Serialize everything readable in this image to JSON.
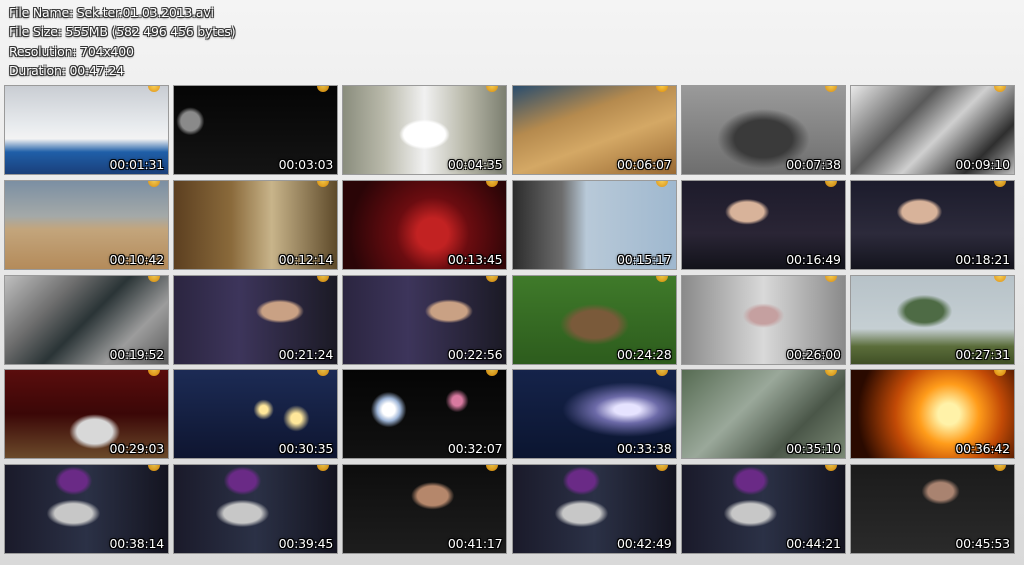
{
  "info": {
    "file_name": "File Name: Sek.ter.01.03.2013.avi",
    "file_size": "File Size: 555MB (582 496 456 bytes)",
    "resolution": "Resolution: 704x400",
    "duration": "Duration: 00:47:24"
  },
  "thumbnails": [
    {
      "time": "00:01:31",
      "scene": "man-in-winter-snow",
      "bg": "linear-gradient(180deg,#c9cdd3 0%,#e8ebee 45%,#f3f3f3 60%,#1f5fa8 75%,#1a3f7a 100%)"
    },
    {
      "time": "00:03:03",
      "scene": "dark-space-asteroid",
      "bg": "radial-gradient(circle at 10% 40%,#8a8a8a 0 6%,transparent 9%),linear-gradient(#050505,#141414)"
    },
    {
      "time": "00:04:35",
      "scene": "hands-holding-paper",
      "bg": "radial-gradient(ellipse at 50% 55%,#ffffff 0 18%,transparent 22%),linear-gradient(90deg,#8a8d7d 0%,#b9b9aa 25%,#f1f1f1 50%,#b9b9aa 75%,#7c7f70 100%)"
    },
    {
      "time": "00:06:07",
      "scene": "ancient-city-model",
      "bg": "linear-gradient(160deg,#2a4d6e 0%,#b58a4e 35%,#d4a865 60%,#9a6a33 100%)"
    },
    {
      "time": "00:07:38",
      "scene": "aerial-crater-bw",
      "bg": "radial-gradient(ellipse at 50% 60%,#3a3a3a 0 25%,transparent 40%),linear-gradient(#9a9a9a,#6e6e6e)"
    },
    {
      "time": "00:09:10",
      "scene": "excavation-bw",
      "bg": "linear-gradient(135deg,#e9e9e9 0%,#5a5a5a 35%,#cfcfcf 55%,#2e2e2e 80%,#bdbdbd 100%)"
    },
    {
      "time": "00:10:42",
      "scene": "desert-dust-storm",
      "bg": "linear-gradient(180deg,#7b8fa3 0%,#a4a9a8 40%,#c3a57c 55%,#b48b5a 100%)"
    },
    {
      "time": "00:12:14",
      "scene": "cave-palm-trees",
      "bg": "linear-gradient(90deg,#5c3f20 0%,#8a6a3b 35%,#c8b48a 60%,#5e4a2a 100%)"
    },
    {
      "time": "00:13:45",
      "scene": "red-planet-surface",
      "bg": "radial-gradient(circle at 55% 60%,#c22222 0 15%,#6b0c10 35%,#2a0507 80%)"
    },
    {
      "time": "00:15:17",
      "scene": "space-capsules",
      "bg": "linear-gradient(90deg,#2c2c2c 0%,#6d6d6d 30%,#b8c9d8 45%,#9fb8cf 100%)"
    },
    {
      "time": "00:16:49",
      "scene": "interview-man-1",
      "bg": "radial-gradient(ellipse at 40% 35%,#d8b39a 0 12%,transparent 16%),linear-gradient(180deg,#1d1b2b 0%,#2a2535 60%,#12121a 100%)"
    },
    {
      "time": "00:18:21",
      "scene": "interview-man-2",
      "bg": "radial-gradient(ellipse at 42% 35%,#d8b39a 0 13%,transparent 17%),linear-gradient(180deg,#1c1c2c 0%,#2c2a3b 60%,#14141d 100%)"
    },
    {
      "time": "00:19:52",
      "scene": "rock-texture",
      "bg": "linear-gradient(135deg,#bfbfbf 0%,#6d6d6d 30%,#2a3436 50%,#9c9c9c 75%,#5a5a5a 100%)"
    },
    {
      "time": "00:21:24",
      "scene": "interview-man-3",
      "bg": "radial-gradient(ellipse at 65% 40%,#c9a184 0 12%,transparent 16%),linear-gradient(90deg,#2b2540 0%,#3d355b 40%,#1b1a25 100%)"
    },
    {
      "time": "00:22:56",
      "scene": "interview-man-4",
      "bg": "radial-gradient(ellipse at 65% 40%,#c9a184 0 12%,transparent 16%),linear-gradient(90deg,#2b2540 0%,#3d355b 40%,#1b1a25 100%)"
    },
    {
      "time": "00:24:28",
      "scene": "jungle-temple",
      "bg": "radial-gradient(ellipse at 50% 55%,#7a5a3a 0 20%,transparent 30%),linear-gradient(#3f7a2a,#2d5c1d)"
    },
    {
      "time": "00:26:00",
      "scene": "temple-statue",
      "bg": "radial-gradient(ellipse at 50% 45%,#c5a0a0 0 12%,transparent 18%),linear-gradient(90deg,#8a8a8a,#d9d9d9 50%,#8a8a8a)"
    },
    {
      "time": "00:27:31",
      "scene": "tree-field",
      "bg": "radial-gradient(ellipse at 45% 40%,#4e6b45 0 15%,transparent 22%),linear-gradient(180deg,#b7c2c8 0%,#c5cfd3 60%,#5b6d3a 80%,#405026 100%)"
    },
    {
      "time": "00:29:03",
      "scene": "compass-on-table",
      "bg": "radial-gradient(ellipse at 55% 70%,#d8d8d8 0 14%,transparent 20%),linear-gradient(180deg,#5a0d0d 0%,#3b0707 50%,#6b4a2a 100%)"
    },
    {
      "time": "00:30:35",
      "scene": "candles-night",
      "bg": "radial-gradient(circle at 55% 45%,#ffe79a 0 4%,transparent 10%),radial-gradient(circle at 75% 55%,#ffe79a 0 4%,transparent 10%),linear-gradient(180deg,#1c2b55 0%,#0e1530 100%)"
    },
    {
      "time": "00:32:07",
      "scene": "dark-lights",
      "bg": "radial-gradient(circle at 28% 45%,#ffffff 0 5%,#9fb6d8 9%,transparent 14%),radial-gradient(circle at 70% 35%,#d87aa0 0 4%,transparent 9%),linear-gradient(#050505,#111)"
    },
    {
      "time": "00:33:38",
      "scene": "presenter-galaxy",
      "bg": "radial-gradient(ellipse at 70% 45%,#e6e3ff 0 8%,#6c6aa8 20%,transparent 40%),linear-gradient(180deg,#15234a 0%,#0b1530 100%)"
    },
    {
      "time": "00:35:10",
      "scene": "rubble-green",
      "bg": "linear-gradient(135deg,#566b52 0%,#9aa89a 40%,#4a5648 70%,#7c8a76 100%)"
    },
    {
      "time": "00:36:42",
      "scene": "explosion-fire",
      "bg": "radial-gradient(circle at 60% 50%,#fff2a8 0 10%,#ff9c1a 28%,#c24a06 50%,#2a0a00 85%)"
    },
    {
      "time": "00:38:14",
      "scene": "priest-interview-1",
      "bg": "radial-gradient(ellipse at 42% 18%,#6a2a86 0 10%,transparent 14%),radial-gradient(ellipse at 42% 55%,#c7c7c7 0 14%,transparent 20%),linear-gradient(90deg,#1a1a2a,#2b3146 50%,#141420)"
    },
    {
      "time": "00:39:45",
      "scene": "priest-interview-2",
      "bg": "radial-gradient(ellipse at 42% 18%,#6a2a86 0 10%,transparent 14%),radial-gradient(ellipse at 42% 55%,#c7c7c7 0 14%,transparent 20%),linear-gradient(90deg,#1a1a2a,#2b3146 50%,#141420)"
    },
    {
      "time": "00:41:17",
      "scene": "woman-interview",
      "bg": "radial-gradient(ellipse at 55% 35%,#b5876b 0 12%,transparent 17%),linear-gradient(180deg,#0d0d0d,#1d1d1d)"
    },
    {
      "time": "00:42:49",
      "scene": "priest-interview-3",
      "bg": "radial-gradient(ellipse at 42% 18%,#6a2a86 0 10%,transparent 14%),radial-gradient(ellipse at 42% 55%,#c7c7c7 0 14%,transparent 20%),linear-gradient(90deg,#1a1a2a,#2b3146 50%,#141420)"
    },
    {
      "time": "00:44:21",
      "scene": "priest-interview-4",
      "bg": "radial-gradient(ellipse at 42% 18%,#6a2a86 0 10%,transparent 14%),radial-gradient(ellipse at 42% 55%,#c7c7c7 0 14%,transparent 20%),linear-gradient(90deg,#1a1a2a,#2b3146 50%,#141420)"
    },
    {
      "time": "00:45:53",
      "scene": "man-interview-dark",
      "bg": "radial-gradient(ellipse at 55% 30%,#a98370 0 10%,transparent 15%),linear-gradient(180deg,#1b1b1b,#2a2a2a)"
    }
  ]
}
